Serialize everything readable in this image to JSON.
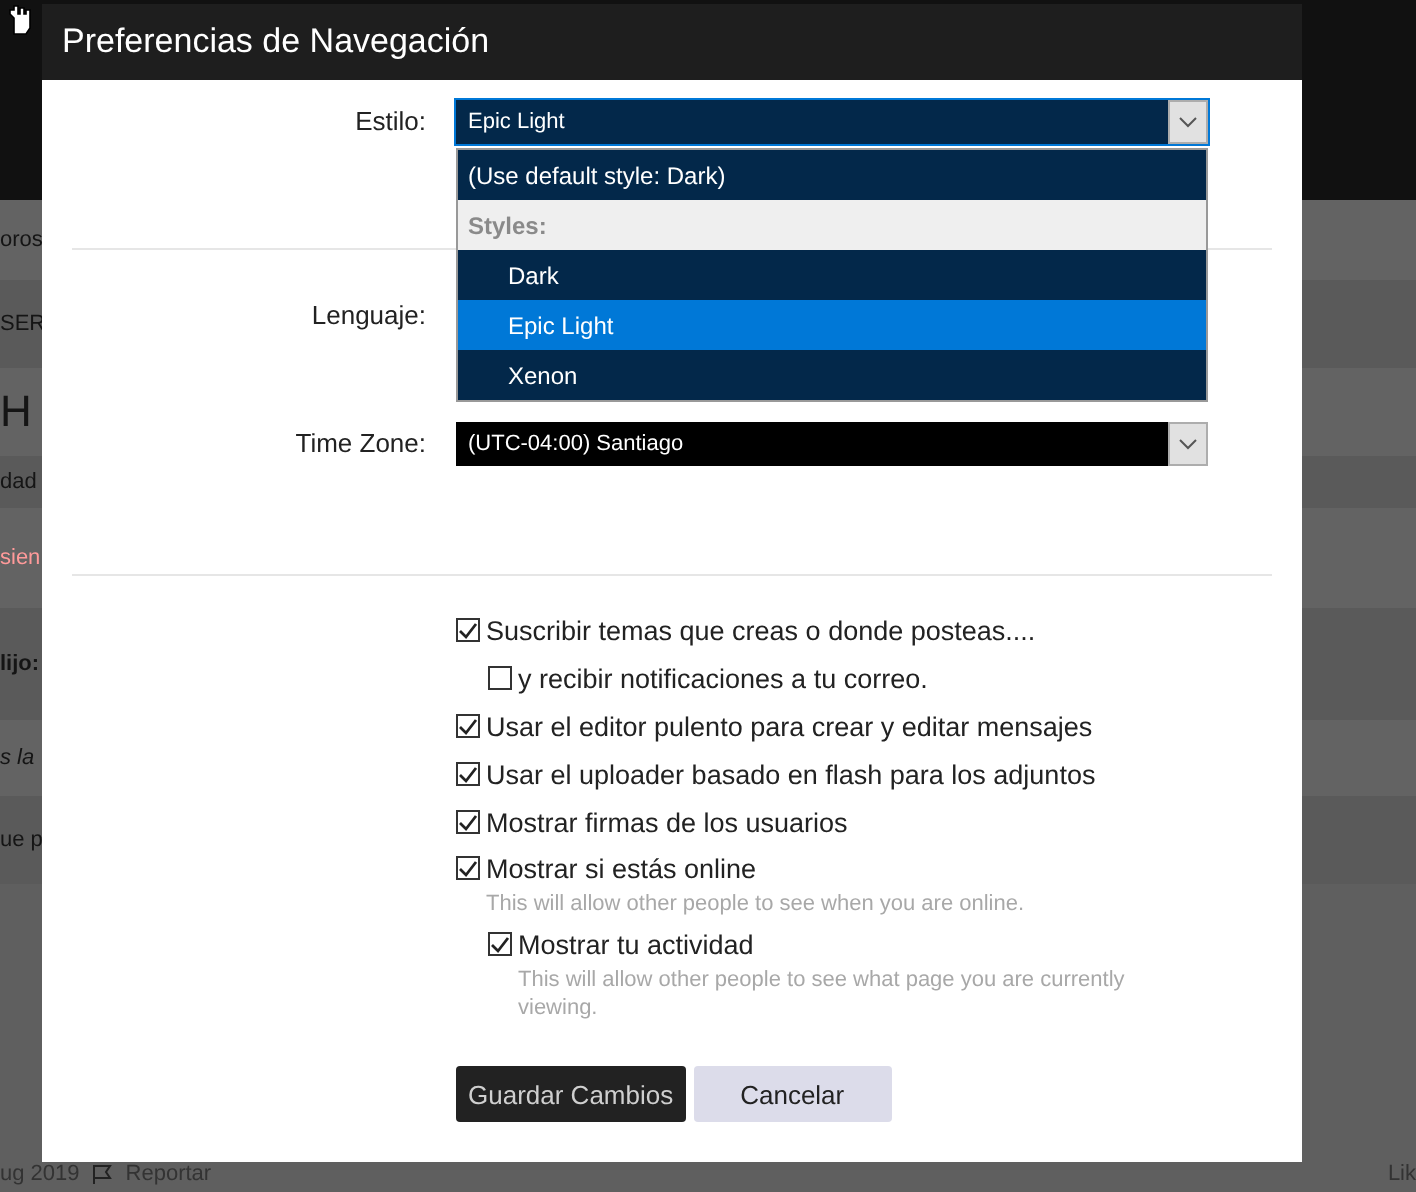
{
  "background_page": {
    "fragments": [
      {
        "text": "oros",
        "kind": "plain"
      },
      {
        "text": "SER",
        "kind": "plain"
      },
      {
        "text": "H",
        "kind": "heading"
      },
      {
        "text": "dad",
        "kind": "plain"
      },
      {
        "text": "sien",
        "kind": "alert"
      },
      {
        "text": "lijo:",
        "kind": "bold"
      },
      {
        "text": "s la",
        "kind": "italic"
      },
      {
        "text": "ue p",
        "kind": "plain"
      }
    ],
    "footer": {
      "date": "ug 2019",
      "report": "Reportar",
      "like": "Lik"
    }
  },
  "dialog": {
    "title": "Preferencias de Navegación",
    "style_field": {
      "label": "Estilo:",
      "value": "Epic Light",
      "expanded": true,
      "options": [
        {
          "label": "(Use default style: Dark)",
          "kind": "option",
          "selected": false
        },
        {
          "label": "Styles:",
          "kind": "group"
        },
        {
          "label": "Dark",
          "kind": "option",
          "selected": false
        },
        {
          "label": "Epic Light",
          "kind": "option",
          "selected": true
        },
        {
          "label": "Xenon",
          "kind": "option",
          "selected": false
        }
      ]
    },
    "language_field": {
      "label": "Lenguaje:"
    },
    "timezone_field": {
      "label": "Time Zone:",
      "value": "(UTC-04:00) Santiago"
    },
    "options": [
      {
        "label": "Suscribir temas que creas o donde posteas....",
        "checked": true,
        "children": [
          {
            "label": "y recibir notificaciones a tu correo.",
            "checked": false
          }
        ]
      },
      {
        "label": "Usar el editor pulento para crear y editar mensajes",
        "checked": true
      },
      {
        "label": "Usar el uploader basado en flash para los adjuntos",
        "checked": true
      },
      {
        "label": "Mostrar firmas de los usuarios",
        "checked": true
      },
      {
        "label": "Mostrar si estás online",
        "checked": true,
        "hint": "This will allow other people to see when you are online.",
        "children": [
          {
            "label": "Mostrar tu actividad",
            "checked": true,
            "hint": "This will allow other people to see what page you are currently viewing."
          }
        ]
      }
    ],
    "buttons": [
      {
        "label": "Guardar Cambios",
        "kind": "primary"
      },
      {
        "label": "Cancelar",
        "kind": "secondary"
      }
    ]
  }
}
